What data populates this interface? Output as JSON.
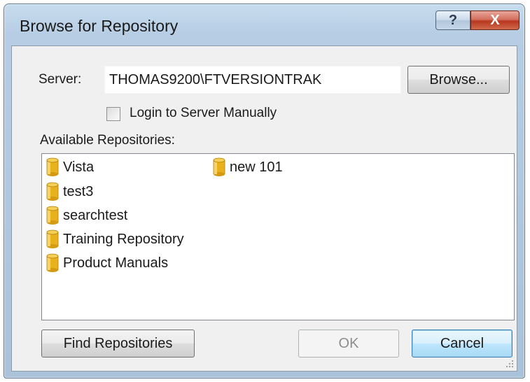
{
  "window": {
    "title": "Browse for Repository",
    "help_label": "?",
    "close_label": "X"
  },
  "server": {
    "label": "Server:",
    "value": "THOMAS9200\\FTVERSIONTRAK",
    "browse_label": "Browse..."
  },
  "login_manually": {
    "label": "Login to Server Manually",
    "checked": false
  },
  "repositories": {
    "label": "Available Repositories:",
    "items": [
      {
        "label": "Vista",
        "icon": "database-icon"
      },
      {
        "label": "test3",
        "icon": "database-icon"
      },
      {
        "label": "searchtest",
        "icon": "database-icon"
      },
      {
        "label": "Training Repository",
        "icon": "database-icon"
      },
      {
        "label": "Product Manuals",
        "icon": "database-icon"
      },
      {
        "label": "new 101",
        "icon": "database-icon"
      }
    ]
  },
  "buttons": {
    "find_label": "Find Repositories",
    "ok_label": "OK",
    "ok_enabled": false,
    "cancel_label": "Cancel"
  },
  "colors": {
    "icon_gold": "#e8b21f",
    "icon_gold_dark": "#b07d0a",
    "default_button_border": "#3c7fb1"
  }
}
